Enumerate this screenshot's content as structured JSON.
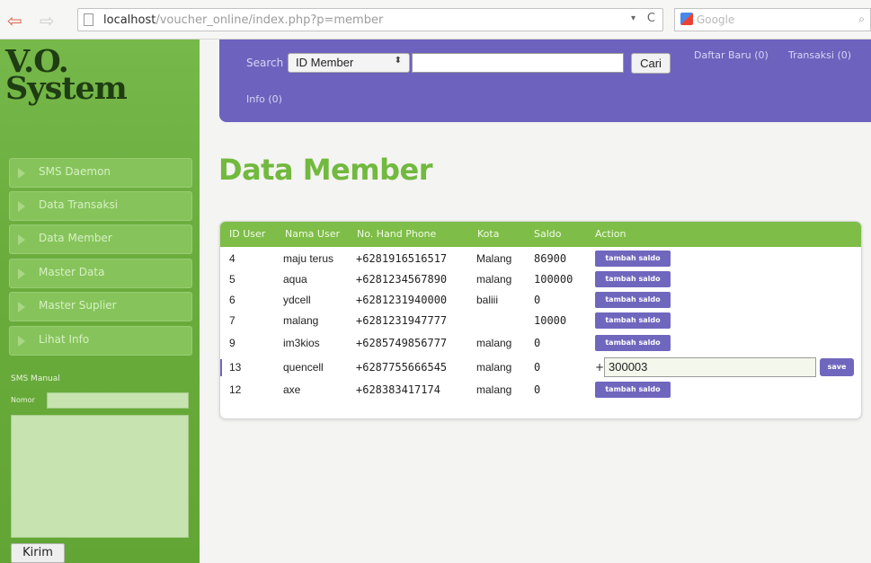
{
  "browser": {
    "url_host": "localhost",
    "url_path": "/voucher_online/index.php?p=member",
    "search_placeholder": "Google"
  },
  "sidebar": {
    "logo_line1": "V.O.",
    "logo_line2": "System",
    "menu": [
      {
        "label": "SMS Daemon"
      },
      {
        "label": "Data Transaksi"
      },
      {
        "label": "Data Member"
      },
      {
        "label": "Master Data"
      },
      {
        "label": "Master Suplier"
      },
      {
        "label": "Lihat Info"
      }
    ],
    "sms_manual_label": "SMS Manual",
    "nomor_label": "Nomor",
    "kirim_label": "Kirim"
  },
  "header": {
    "search_label": "Search :",
    "search_field_selected": "ID Member",
    "cari_label": "Cari",
    "daftar_baru": "Daftar Baru (0)",
    "transaksi": "Transaksi (0)",
    "info": "Info (0)"
  },
  "page_title": "Data Member",
  "table": {
    "columns": [
      "ID User",
      "Nama User",
      "No. Hand Phone",
      "Kota",
      "Saldo",
      "Action"
    ],
    "action_label": "tambah saldo",
    "rows": [
      {
        "id": "4",
        "nama": "maju terus",
        "hp": "+6281916516517",
        "kota": "Malang",
        "saldo": "86900"
      },
      {
        "id": "5",
        "nama": "aqua",
        "hp": "+6281234567890",
        "kota": "malang",
        "saldo": "100000"
      },
      {
        "id": "6",
        "nama": "ydcell",
        "hp": "+6281231940000",
        "kota": "baliii",
        "saldo": "0"
      },
      {
        "id": "7",
        "nama": "malang",
        "hp": "+6281231947777",
        "kota": "",
        "saldo": "10000"
      },
      {
        "id": "9",
        "nama": "im3kios",
        "hp": "+6285749856777",
        "kota": "malang",
        "saldo": "0"
      },
      {
        "id": "13",
        "nama": "quencell",
        "hp": "+6287755666545",
        "kota": "malang",
        "saldo": "0"
      },
      {
        "id": "12",
        "nama": "axe",
        "hp": "+628383417174",
        "kota": "malang",
        "saldo": "0"
      }
    ],
    "edit_row": {
      "plus": "+",
      "value": "300003",
      "save_label": "save"
    }
  },
  "colors": {
    "sidebar_green": "#6bad3d",
    "header_purple": "#6d63be",
    "table_header_green": "#7ebd47",
    "title_green": "#72b93f",
    "button_purple": "#6f67bd"
  }
}
